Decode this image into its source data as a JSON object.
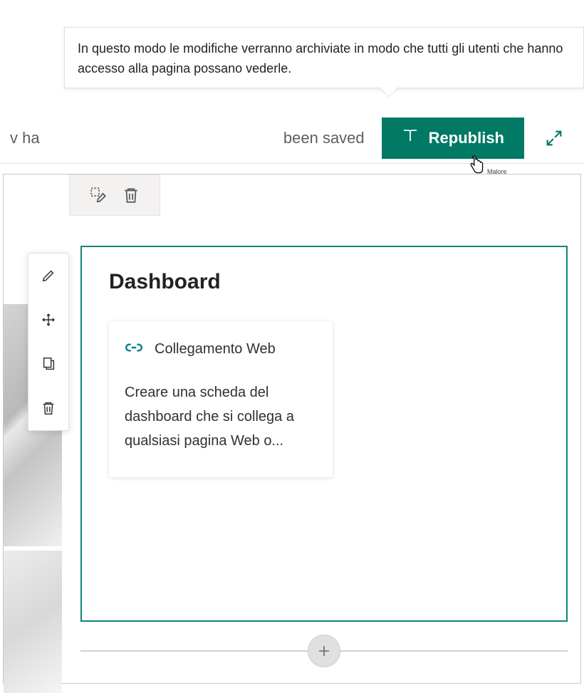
{
  "tooltip": {
    "text": "In questo modo le modifiche verranno archiviate in modo che tutti gli utenti che hanno accesso alla pagina possano vederle."
  },
  "toolbar": {
    "fragment1": "v ha",
    "fragment2": "been saved",
    "republish_label": "Republish",
    "cursor_label": "Malore"
  },
  "small_toolbar": {
    "edit_name": "select-edit",
    "delete_name": "delete"
  },
  "vertical_tools": {
    "items": [
      "edit",
      "move",
      "duplicate",
      "delete"
    ]
  },
  "dashboard": {
    "title": "Dashboard",
    "card": {
      "header": "Collegamento Web",
      "description": "Creare una scheda del dashboard che si collega a qualsiasi pagina Web o..."
    }
  },
  "colors": {
    "accent": "#007965",
    "panel_border": "#0f8574"
  }
}
